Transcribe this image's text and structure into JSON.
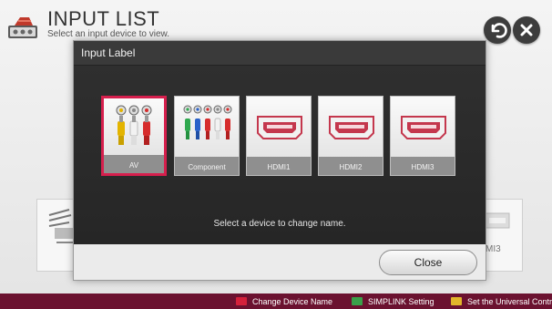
{
  "header": {
    "title": "INPUT LIST",
    "subtitle": "Select an input device to view."
  },
  "background": {
    "right_card_label": "MI3"
  },
  "dialog": {
    "title": "Input Label",
    "devices": [
      {
        "label": "AV",
        "icon": "av-connector-icon",
        "selected": true
      },
      {
        "label": "Component",
        "icon": "component-connector-icon",
        "selected": false
      },
      {
        "label": "HDMI1",
        "icon": "hdmi-port-icon",
        "selected": false
      },
      {
        "label": "HDMI2",
        "icon": "hdmi-port-icon",
        "selected": false
      },
      {
        "label": "HDMI3",
        "icon": "hdmi-port-icon",
        "selected": false
      }
    ],
    "prompt": "Select a device to change name.",
    "close_label": "Close"
  },
  "bottom_bar": {
    "hints": [
      {
        "key_color": "#d4213b",
        "label": "Change Device Name"
      },
      {
        "key_color": "#3aa04a",
        "label": "SIMPLINK Setting"
      },
      {
        "key_color": "#e2b52a",
        "label": "Set the Universal Contro"
      }
    ]
  },
  "colors": {
    "accent": "#d61f4d",
    "bottom_bar": "#6b1230",
    "dialog_body": "#2b2b2b"
  }
}
